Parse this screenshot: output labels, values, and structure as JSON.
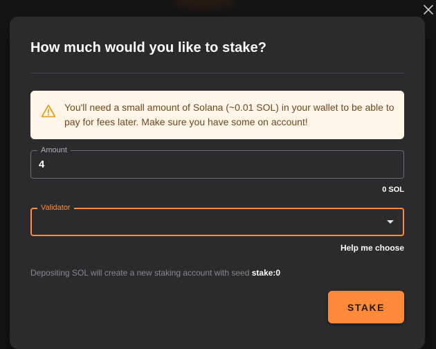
{
  "modal": {
    "title": "How much would you like to stake?",
    "alert": {
      "icon": "warning-icon",
      "text": "You'll need a small amount of Solana (~0.01 SOL) in your wallet to be able to pay for fees later. Make sure you have some on account!"
    },
    "amount": {
      "label": "Amount",
      "value": "4"
    },
    "balance": "0 SOL",
    "validator": {
      "label": "Validator",
      "value": ""
    },
    "help_link": "Help me choose",
    "info_text": "Depositing SOL will create a new staking account with seed",
    "seed": "stake:0",
    "stake_button": "STAKE"
  },
  "colors": {
    "accent": "#ff8c3a",
    "modal_bg": "#2b2a2c",
    "alert_bg": "#fff5e8",
    "alert_text": "#6b4a22"
  }
}
